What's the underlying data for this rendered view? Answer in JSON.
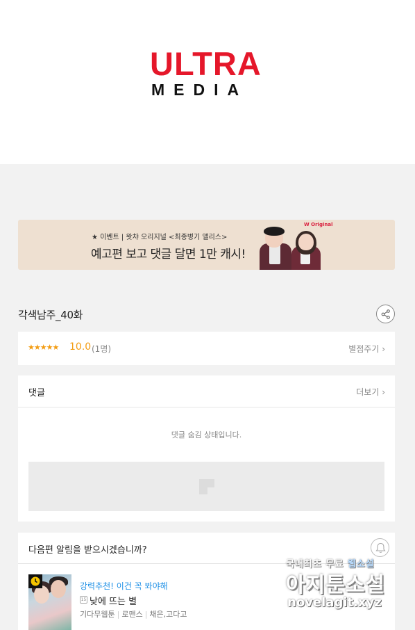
{
  "logo": {
    "top_text": "ULTRA",
    "bottom_text": "MEDIA"
  },
  "banner": {
    "subtitle": "★ 이벤트 | 왓챠 오리지널 <최종병기 앨리스>",
    "title": "예고편 보고 댓글 달면 1만 캐시!",
    "badge": "W Original"
  },
  "episode": {
    "title": "각색남주_40화"
  },
  "rating": {
    "stars": "★★★★★",
    "score": "10.0",
    "count": "(1명)",
    "action_label": "별점주기 ›"
  },
  "comments": {
    "title": "댓글",
    "more_label": "더보기 ›",
    "empty_text": "댓글 숨김 상태입니다."
  },
  "notify": {
    "question": "다음편 알림을 받으시겠습니까?",
    "recommend": {
      "label": "강력추천! 이건 꼭 봐야해",
      "age": "15",
      "title": "낮에 뜨는 별",
      "category": "기다무웹툰",
      "genre": "로맨스",
      "authors": "채은,고다고"
    }
  },
  "watermark": {
    "line1_prefix": "국내최초 무료 ",
    "line1_highlight": "웹소설",
    "line2": "아지툰소설",
    "url": "novelagit.xyz"
  },
  "colors": {
    "accent_red": "#e5172a",
    "link_blue": "#1e90e6",
    "rating_orange": "#f39c12",
    "banner_bg": "#eee0d1"
  },
  "icons": [
    "share-icon",
    "chevron-right-icon",
    "bell-icon",
    "clock-icon",
    "ad-placeholder-icon"
  ]
}
